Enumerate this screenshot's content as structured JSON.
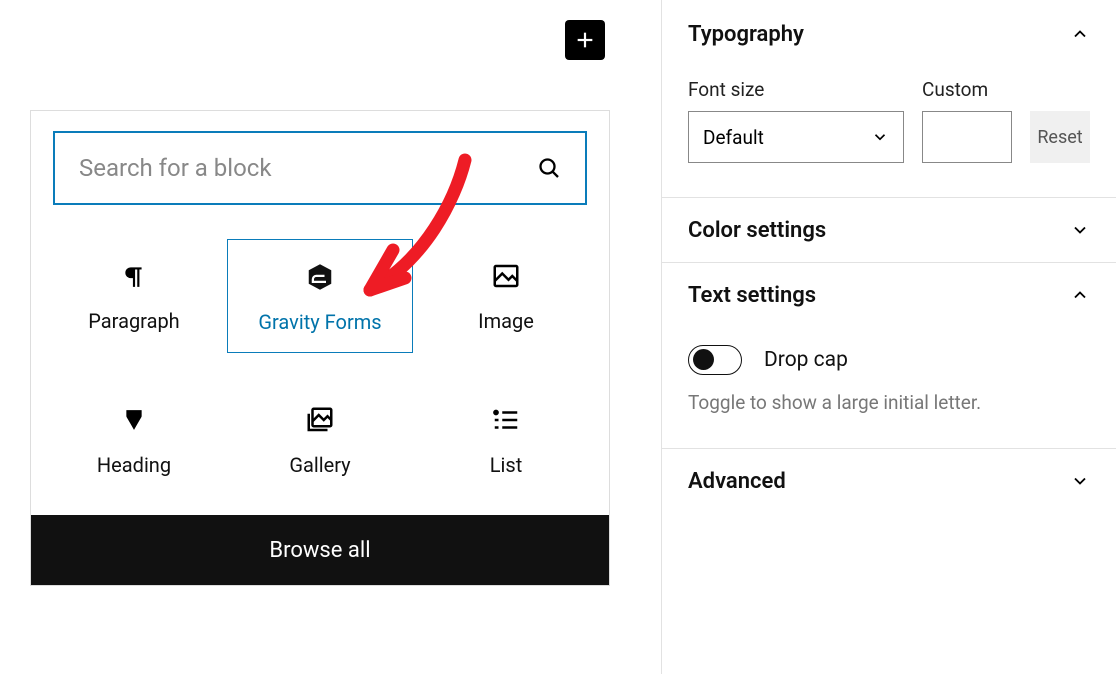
{
  "add_button_title": "Add block",
  "search": {
    "placeholder": "Search for a block"
  },
  "blocks": [
    {
      "name": "paragraph",
      "label": "Paragraph"
    },
    {
      "name": "gravity-forms",
      "label": "Gravity Forms",
      "selected": true
    },
    {
      "name": "image",
      "label": "Image"
    },
    {
      "name": "heading",
      "label": "Heading"
    },
    {
      "name": "gallery",
      "label": "Gallery"
    },
    {
      "name": "list",
      "label": "List"
    }
  ],
  "browse_all_label": "Browse all",
  "sidebar": {
    "typography": {
      "title": "Typography",
      "font_size_label": "Font size",
      "font_size_value": "Default",
      "custom_label": "Custom",
      "custom_value": "",
      "reset_label": "Reset"
    },
    "color": {
      "title": "Color settings"
    },
    "text": {
      "title": "Text settings",
      "drop_cap_label": "Drop cap",
      "drop_cap_on": false,
      "help": "Toggle to show a large initial letter."
    },
    "advanced": {
      "title": "Advanced"
    }
  }
}
